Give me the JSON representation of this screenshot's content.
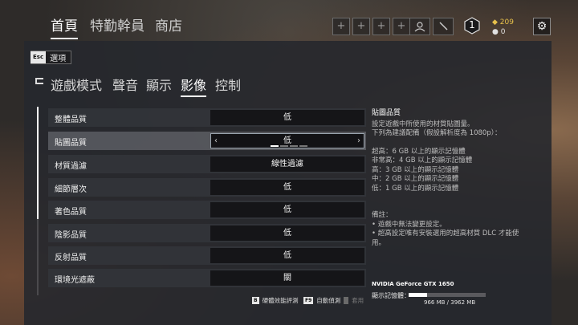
{
  "top_nav": {
    "tabs": [
      {
        "label": "首頁",
        "active": true
      },
      {
        "label": "特勤幹員",
        "active": false
      },
      {
        "label": "商店",
        "active": false
      }
    ],
    "level": "1",
    "currency_renown": "209",
    "currency_credits": "0"
  },
  "back_button": {
    "key": "Esc",
    "label": "選項"
  },
  "sub_tabs": [
    {
      "label": "遊戲模式",
      "active": false
    },
    {
      "label": "聲音",
      "active": false
    },
    {
      "label": "顯示",
      "active": false
    },
    {
      "label": "影像",
      "active": true
    },
    {
      "label": "控制",
      "active": false
    }
  ],
  "settings": [
    {
      "label": "整體品質",
      "value": "低"
    },
    {
      "label": "貼圖品質",
      "value": "低",
      "selected": true
    },
    {
      "label": "材質過濾",
      "value": "線性過濾"
    },
    {
      "label": "細節層次",
      "value": "低"
    },
    {
      "label": "著色品質",
      "value": "低"
    },
    {
      "label": "陰影品質",
      "value": "低"
    },
    {
      "label": "反射品質",
      "value": "低"
    },
    {
      "label": "環境光遮蔽",
      "value": "關"
    }
  ],
  "info": {
    "title": "貼圖品質",
    "description1": "設定遊戲中所使用的材質貼圖量。",
    "description2": "下列為建議配備（假設解析度為 1080p）：",
    "req_ultra": "超高：6 GB 以上的顯示記憶體",
    "req_very_high": "非常高：4 GB 以上的顯示記憶體",
    "req_high": "高：3 GB 以上的顯示記憶體",
    "req_medium": "中：2 GB 以上的顯示記憶體",
    "req_low": "低：1 GB 以上的顯示記憶體",
    "note_title": "備註：",
    "note1": "• 遊戲中無法變更設定。",
    "note2": "• 超高設定唯有安裝選用的超高材質 DLC 才能使",
    "note3": "用。"
  },
  "gpu": {
    "name": "NVIDIA GeForce GTX 1650",
    "vram_label": "顯示記憶體：",
    "vram_usage": "966 MB / 3962 MB",
    "vram_used_mb": 966,
    "vram_total_mb": 3962
  },
  "footer": {
    "benchmark_key": "B",
    "benchmark_label": "硬體效能評測",
    "autodetect_key": "F9",
    "autodetect_label": "自動偵測",
    "apply_label": "套用"
  }
}
